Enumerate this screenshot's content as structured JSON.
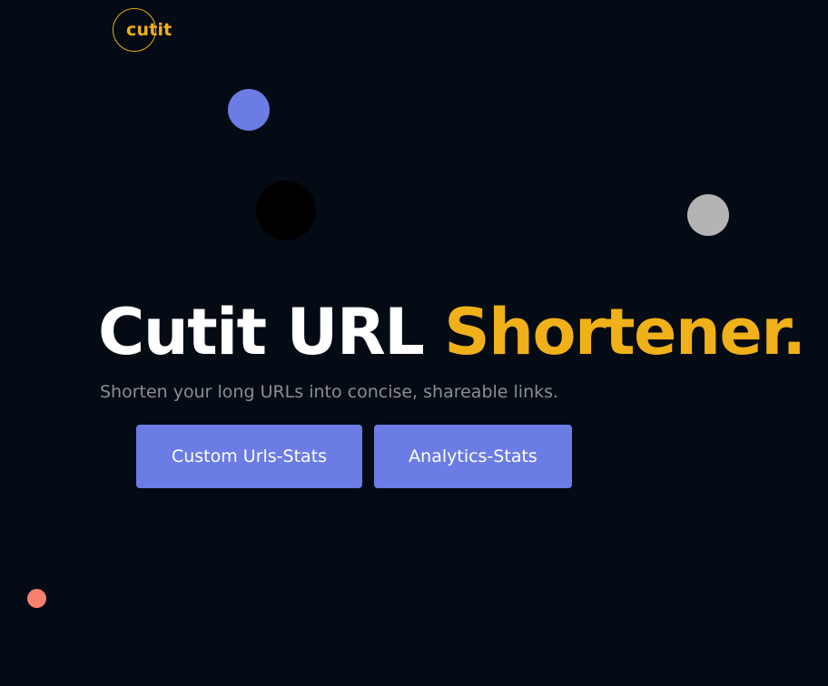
{
  "brand": {
    "logo_text": "cutit",
    "accent_color": "#f0b01a",
    "background_color": "#050b14"
  },
  "hero": {
    "title_main": "Cutit URL ",
    "title_accent": "Shortener.",
    "subtitle": "Shorten your long URLs into concise, shareable links."
  },
  "actions": {
    "custom_urls_label": "Custom Urls-Stats",
    "analytics_label": "Analytics-Stats",
    "button_color": "#6b7ce4"
  },
  "decorations": {
    "dot_colors": [
      "#6b7ce4",
      "#000000",
      "#b4b4b4",
      "#f7816d"
    ]
  }
}
